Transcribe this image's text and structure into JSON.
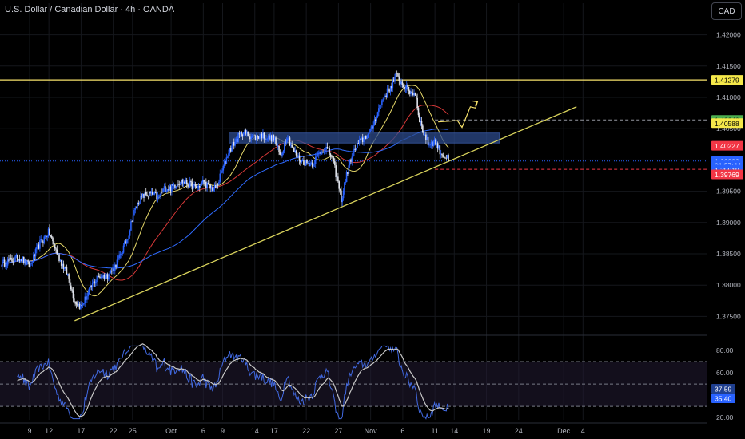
{
  "header": {
    "title": "U.S. Dollar / Canadian Dollar · 4h · OANDA",
    "currency_button": "CAD"
  },
  "colors": {
    "background": "#000000",
    "up_candle": "#2962ff",
    "down_candle": "#e0e3eb",
    "resistance": "#f7e26b",
    "trendline": "#d9d35c",
    "ma_fast": "#e6d86a",
    "ma_mid": "#d63838",
    "ma_slow": "#2f6bff",
    "zone_fill": "#2c4a8a",
    "rsi_line": "#4169e1",
    "rsi_signal": "#c8c8c8",
    "rsi_band": "#231b33"
  },
  "chart_data": [
    {
      "type": "candlestick",
      "symbol": "USDCAD",
      "interval": "4h",
      "ylim": [
        1.3725,
        1.4225
      ],
      "y_ticks": [
        "1.42000",
        "1.41500",
        "1.41000",
        "1.40500",
        "1.40000",
        "1.39500",
        "1.39000",
        "1.38500",
        "1.38000",
        "1.37500"
      ],
      "x_ticks": [
        {
          "label": "9",
          "day": 0
        },
        {
          "label": "12",
          "day": 3
        },
        {
          "label": "17",
          "day": 8
        },
        {
          "label": "22",
          "day": 13
        },
        {
          "label": "25",
          "day": 16
        },
        {
          "label": "Oct",
          "day": 22
        },
        {
          "label": "6",
          "day": 27
        },
        {
          "label": "9",
          "day": 30
        },
        {
          "label": "14",
          "day": 35
        },
        {
          "label": "17",
          "day": 38
        },
        {
          "label": "22",
          "day": 43
        },
        {
          "label": "27",
          "day": 48
        },
        {
          "label": "Nov",
          "day": 53
        },
        {
          "label": "6",
          "day": 58
        },
        {
          "label": "11",
          "day": 63
        },
        {
          "label": "14",
          "day": 66
        },
        {
          "label": "19",
          "day": 71
        },
        {
          "label": "24",
          "day": 76
        },
        {
          "label": "Dec",
          "day": 83
        },
        {
          "label": "4",
          "day": 86
        }
      ],
      "last_day": 65.2,
      "anchors": [
        [
          -4,
          1.3835
        ],
        [
          -1.5,
          1.3845
        ],
        [
          0,
          1.383
        ],
        [
          1.5,
          1.3865
        ],
        [
          3,
          1.3885
        ],
        [
          4.5,
          1.3845
        ],
        [
          6,
          1.3815
        ],
        [
          7,
          1.3775
        ],
        [
          8,
          1.3765
        ],
        [
          9,
          1.3785
        ],
        [
          10,
          1.3805
        ],
        [
          11,
          1.3815
        ],
        [
          12,
          1.3815
        ],
        [
          13,
          1.3825
        ],
        [
          14,
          1.3845
        ],
        [
          15,
          1.387
        ],
        [
          15.5,
          1.3885
        ],
        [
          16,
          1.391
        ],
        [
          17,
          1.3935
        ],
        [
          18,
          1.3945
        ],
        [
          19,
          1.3945
        ],
        [
          20,
          1.394
        ],
        [
          21,
          1.3955
        ],
        [
          22,
          1.3955
        ],
        [
          23,
          1.3965
        ],
        [
          24,
          1.3965
        ],
        [
          25,
          1.396
        ],
        [
          26,
          1.3955
        ],
        [
          27,
          1.3965
        ],
        [
          28,
          1.3955
        ],
        [
          29,
          1.3955
        ],
        [
          30,
          1.3985
        ],
        [
          31,
          1.4015
        ],
        [
          32,
          1.403
        ],
        [
          33,
          1.4045
        ],
        [
          34,
          1.404
        ],
        [
          35,
          1.4035
        ],
        [
          36,
          1.404
        ],
        [
          37,
          1.4035
        ],
        [
          38,
          1.4035
        ],
        [
          39,
          1.4005
        ],
        [
          40,
          1.404
        ],
        [
          41,
          1.4015
        ],
        [
          42,
          1.4
        ],
        [
          43,
          1.3995
        ],
        [
          44,
          1.3995
        ],
        [
          45,
          1.401
        ],
        [
          46,
          1.402
        ],
        [
          47,
          1.4005
        ],
        [
          48,
          1.396
        ],
        [
          48.5,
          1.3935
        ],
        [
          49,
          1.3965
        ],
        [
          50,
          1.4005
        ],
        [
          51,
          1.4025
        ],
        [
          52,
          1.4035
        ],
        [
          53,
          1.4045
        ],
        [
          54,
          1.4075
        ],
        [
          55,
          1.41
        ],
        [
          56,
          1.4115
        ],
        [
          57,
          1.4135
        ],
        [
          58,
          1.412
        ],
        [
          59,
          1.411
        ],
        [
          60,
          1.4105
        ],
        [
          60.5,
          1.407
        ],
        [
          61,
          1.405
        ],
        [
          62,
          1.4025
        ],
        [
          63,
          1.403
        ],
        [
          64,
          1.401
        ],
        [
          65.2,
          1.4
        ]
      ],
      "price_labels": [
        {
          "text": "1.41279",
          "value": 1.41279,
          "color": "#f5e84a",
          "text_color": "#000000"
        },
        {
          "text": "1.40640",
          "value": 1.4064,
          "color": "#4caf50",
          "text_color": "#000000"
        },
        {
          "text": "1.40588",
          "value": 1.40588,
          "color": "#f5e84a",
          "text_color": "#000000"
        },
        {
          "text": "1.40227",
          "value": 1.40227,
          "color": "#f23645",
          "text_color": "#ffffff"
        },
        {
          "text": "1.39982",
          "value": 1.39982,
          "color": "#2962ff",
          "text_color": "#ffffff"
        },
        {
          "text": "01:57:44",
          "value": 1.39915,
          "color": "#2962ff",
          "text_color": "#ffffff"
        },
        {
          "text": "1.39919",
          "value": 1.39848,
          "color": "#2962ff",
          "text_color": "#ffffff"
        },
        {
          "text": "1.39769",
          "value": 1.39769,
          "color": "#f23645",
          "text_color": "#ffffff"
        }
      ],
      "resistance_level": 1.41279,
      "upper_dashed_level": 1.4064,
      "lower_dashed_level": 1.3985,
      "current_price": 1.39982,
      "zone": {
        "day_from": 31,
        "day_to": 73,
        "low": 1.4027,
        "high": 1.4043
      },
      "trendline": {
        "from": [
          7,
          1.3743
        ],
        "to": [
          85,
          1.4085
        ]
      },
      "projection": [
        [
          63.5,
          1.4061
        ],
        [
          66.5,
          1.4063
        ],
        [
          67.2,
          1.4052
        ],
        [
          68.5,
          1.4085
        ],
        [
          69.3,
          1.4083
        ],
        [
          69.6,
          1.4093
        ]
      ]
    },
    {
      "type": "line",
      "name": "RSI",
      "ylim": [
        18,
        85
      ],
      "y_ticks": [
        "80.00",
        "60.00",
        "40.00",
        "20.00"
      ],
      "levels": [
        70,
        50,
        30
      ],
      "rsi_value": "37.59",
      "signal_value": "35.40"
    }
  ]
}
